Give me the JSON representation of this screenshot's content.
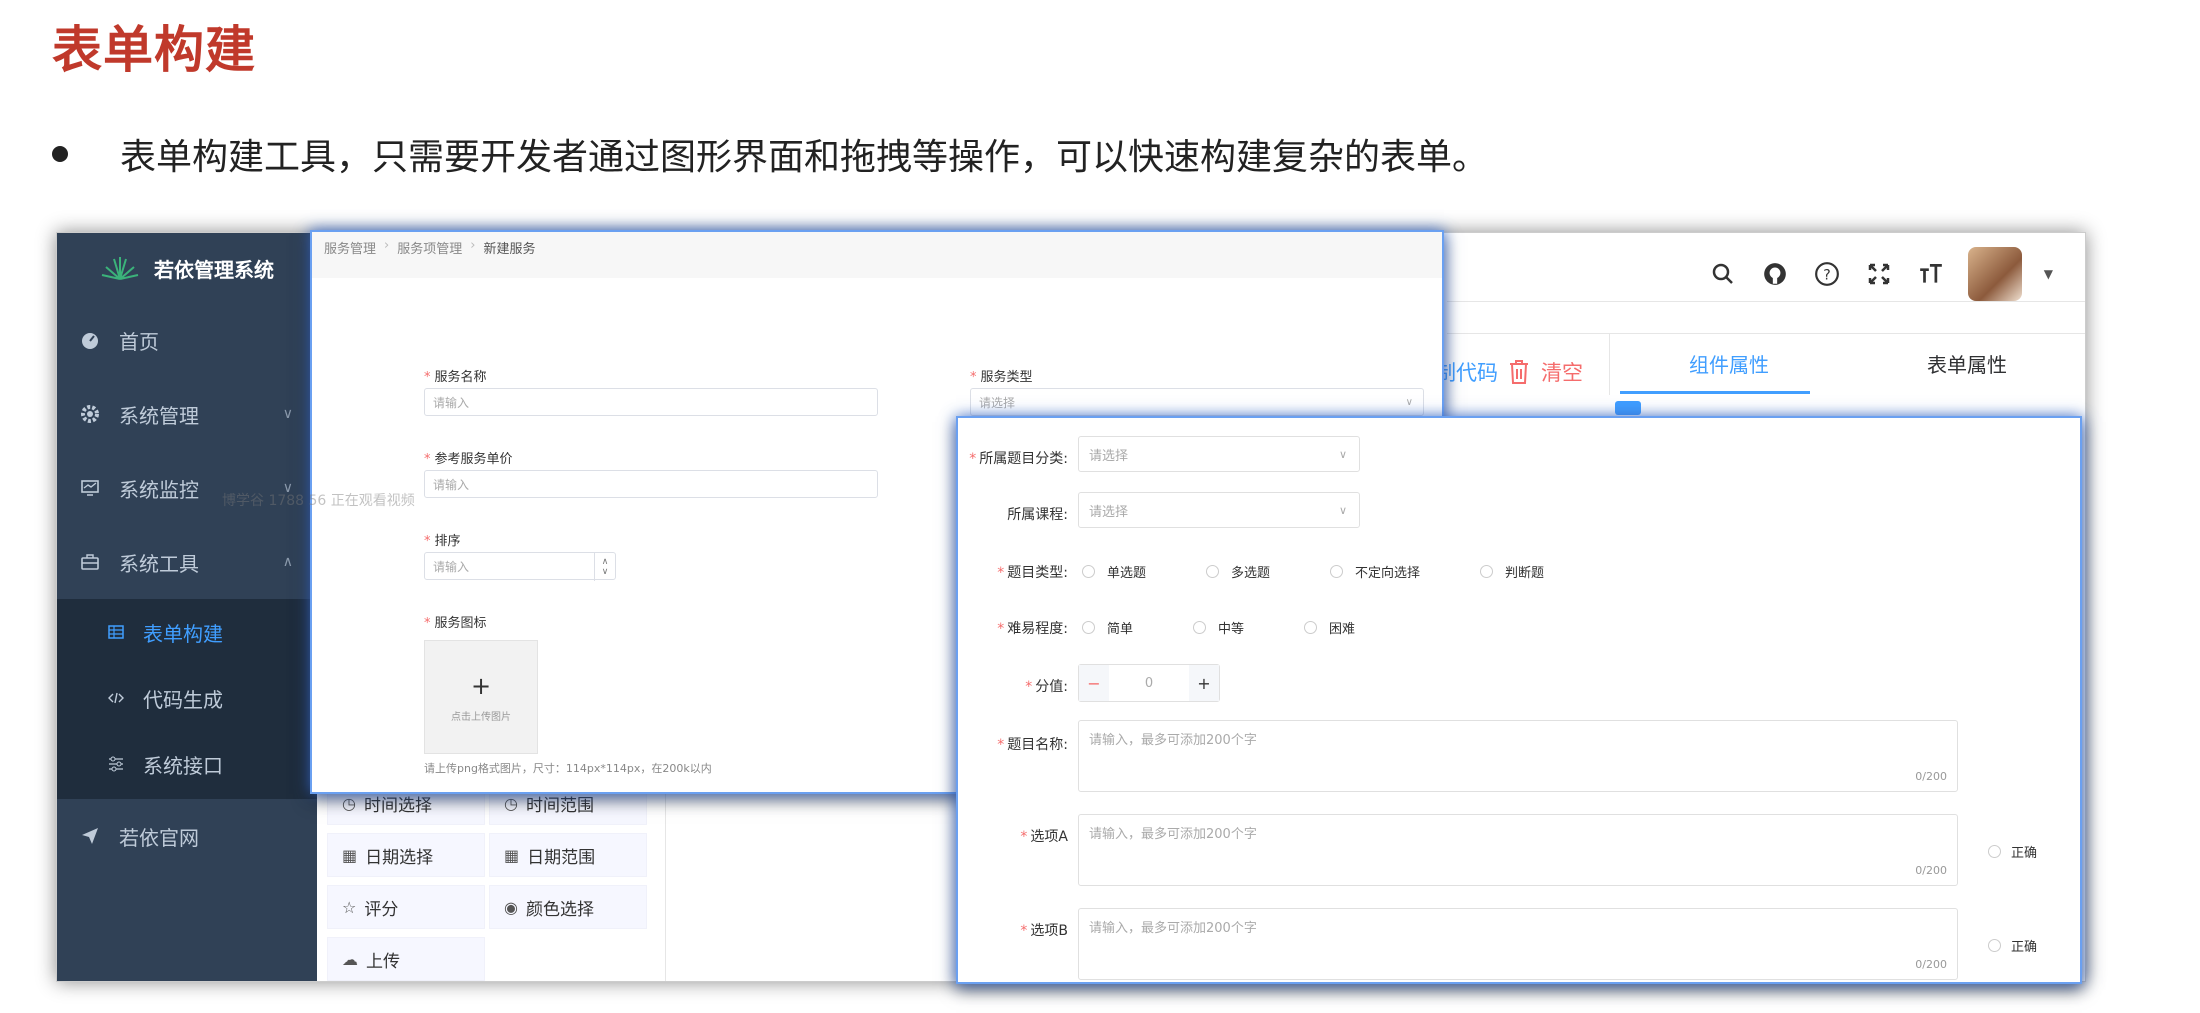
{
  "slide": {
    "title": "表单构建",
    "bullet": "表单构建工具，只需要开发者通过图形界面和拖拽等操作，可以快速构建复杂的表单。"
  },
  "sidebar": {
    "app_name": "若依管理系统",
    "items": [
      {
        "label": "首页",
        "icon": "dashboard-icon"
      },
      {
        "label": "系统管理",
        "icon": "gear-icon"
      },
      {
        "label": "系统监控",
        "icon": "monitor-icon"
      },
      {
        "label": "系统工具",
        "icon": "toolbox-icon"
      }
    ],
    "sub_items": [
      {
        "label": "表单构建",
        "icon": "table-icon"
      },
      {
        "label": "代码生成",
        "icon": "code-icon"
      },
      {
        "label": "系统接口",
        "icon": "sliders-icon"
      }
    ],
    "external": {
      "label": "若依官网",
      "icon": "send-icon"
    }
  },
  "toolbar": {
    "copy_code": "制代码",
    "clear": "清空"
  },
  "property_tabs": [
    "组件属性",
    "表单属性"
  ],
  "components": [
    "时间选择",
    "时间范围",
    "日期选择",
    "日期范围",
    "评分",
    "颜色选择",
    "上传"
  ],
  "service_form": {
    "breadcrumb": [
      "服务管理",
      "服务项管理",
      "新建服务"
    ],
    "name_label": "服务名称",
    "name_placeholder": "请输入",
    "type_label": "服务类型",
    "type_placeholder": "请选择",
    "price_label": "参考服务单价",
    "price_placeholder": "请输入",
    "sort_label": "排序",
    "sort_placeholder": "请输入",
    "icon_label": "服务图标",
    "upload_text": "点击上传图片",
    "upload_hint": "请上传png格式图片，尺寸：114px*114px，在200k以内",
    "watermark": "博学谷 1788 56 正在观看视频"
  },
  "question_form": {
    "category_label": "所属题目分类:",
    "category_placeholder": "请选择",
    "course_label": "所属课程:",
    "course_placeholder": "请选择",
    "qtype_label": "题目类型:",
    "qtype_options": [
      "单选题",
      "多选题",
      "不定向选择",
      "判断题"
    ],
    "difficulty_label": "难易程度:",
    "difficulty_options": [
      "简单",
      "中等",
      "困难"
    ],
    "score_label": "分值:",
    "score_value": "0",
    "score_minus": "−",
    "score_plus": "+",
    "name_label": "题目名称:",
    "textarea_placeholder": "请输入，最多可添加200个字",
    "counter": "0/200",
    "option_a_label": "选项A",
    "option_b_label": "选项B",
    "correct_label": "正确"
  }
}
